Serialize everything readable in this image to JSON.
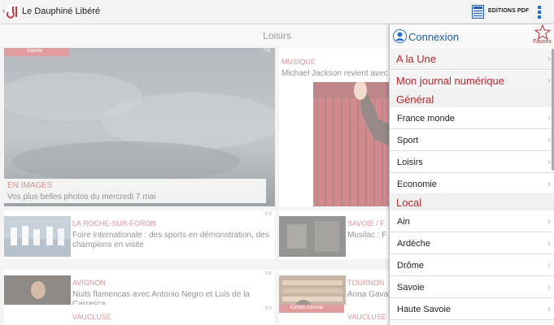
{
  "app": {
    "title": "Le Dauphiné Libéré",
    "pdf_label": "EDITIONS PDF",
    "brand_color": "#b4282e",
    "accent_color": "#1f6fd1",
    "icons": [
      "back-chevron-icon",
      "logo-icon",
      "pdf-icon",
      "overflow-menu-icon"
    ]
  },
  "section": {
    "title": "Loisirs"
  },
  "hero": {
    "tag": "Galerie",
    "count": "7/8",
    "kicker": "EN IMAGES",
    "title": "Vos plus belles photos du mercredi 7 mai"
  },
  "featured": {
    "kicker": "MUSIQUE",
    "title": "Michael Jackson revient avec"
  },
  "articles": [
    {
      "kicker": "LA ROCHE-SUR-FORON",
      "title": "Foire internationale : des sports en démonstration, des champions en visite",
      "time": "9 h"
    },
    {
      "kicker": "AVIGNON",
      "title": "Nuits flamencas avec Antonio Negro et Luis de la Carrasca",
      "time": "9 h"
    },
    {
      "kicker": "VAUCLUSE",
      "title": "",
      "time": "9 h"
    }
  ],
  "side_articles": [
    {
      "kicker": "SAVOIE / F",
      "title": "Musilac : F",
      "time": "9 h"
    },
    {
      "kicker": "TOURNON",
      "title": "Anna Gaval",
      "time": "9 h"
    },
    {
      "kicker": "VAUCLUSE",
      "title": "",
      "tag": "Edition Abonné"
    }
  ],
  "drawer": {
    "connexion": "Connexion",
    "favoris": "Favoris",
    "top_items": [
      {
        "label": "A la Une"
      },
      {
        "label": "Mon journal numérique"
      }
    ],
    "general_header": "Général",
    "general_items": [
      {
        "label": "France monde"
      },
      {
        "label": "Sport"
      },
      {
        "label": "Loisirs"
      },
      {
        "label": "Economie"
      }
    ],
    "local_header": "Local",
    "local_items": [
      {
        "label": "Ain"
      },
      {
        "label": "Ardèche"
      },
      {
        "label": "Drôme"
      },
      {
        "label": "Savoie"
      },
      {
        "label": "Haute Savoie"
      }
    ],
    "chevron": "›"
  }
}
